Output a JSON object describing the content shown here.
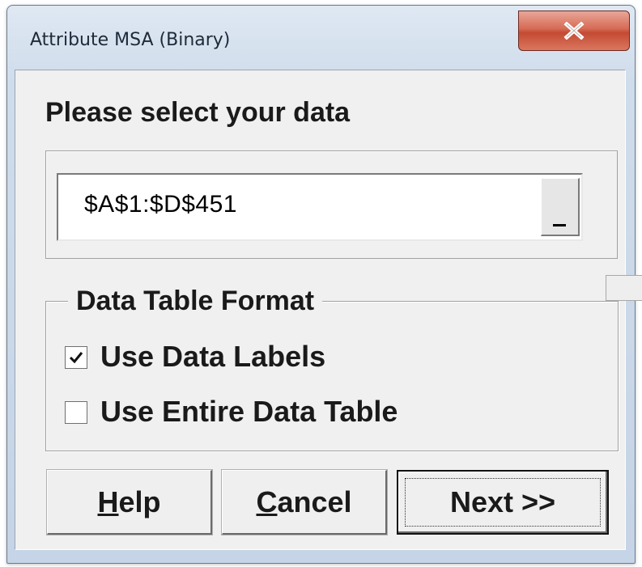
{
  "window": {
    "title": "Attribute MSA (Binary)",
    "close_icon": "close-icon"
  },
  "main": {
    "heading": "Please select your data",
    "range": {
      "value": "$A$1:$D$451",
      "ref_button_icon": "range-select-icon"
    }
  },
  "format_group": {
    "legend": "Data Table Format",
    "options": [
      {
        "label": "Use Data Labels",
        "checked": true
      },
      {
        "label": "Use Entire Data Table",
        "checked": false
      }
    ]
  },
  "buttons": {
    "help": {
      "mnemonic": "H",
      "rest": "elp"
    },
    "cancel": {
      "mnemonic": "C",
      "rest": "ancel"
    },
    "next": "Next >>"
  }
}
